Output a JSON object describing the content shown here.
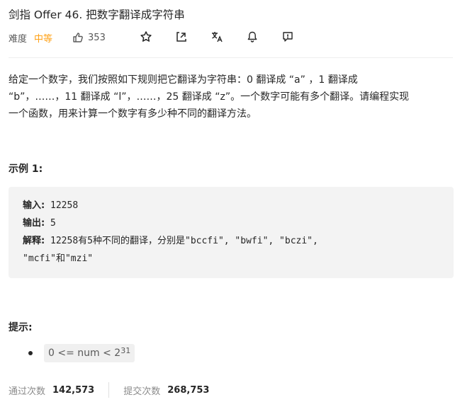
{
  "problem": {
    "title": "剑指 Offer 46. 把数字翻译成字符串",
    "difficulty_label": "难度",
    "difficulty_value": "中等",
    "likes": "353",
    "difficulty_color": "#ffa116"
  },
  "icons": {
    "like": "thumbs-up-icon",
    "star": "star-icon",
    "share": "share-icon",
    "translate": "translate-icon",
    "bell": "bell-icon",
    "feedback": "feedback-icon"
  },
  "description": {
    "line1": "给定一个数字，我们按照如下规则把它翻译为字符串：0 翻译成 “a” ，1 翻译成",
    "line2": "“b”，……，11 翻译成 “l”，……，25 翻译成 “z”。一个数字可能有多个翻译。请编程实现",
    "line3": "一个函数，用来计算一个数字有多少种不同的翻译方法。"
  },
  "example": {
    "heading": "示例 1:",
    "input_label": "输入:",
    "input_value": "12258",
    "output_label": "输出:",
    "output_value": "5",
    "explain_label": "解释:",
    "explain_line1": "12258有5种不同的翻译，分别是\"bccfi\", \"bwfi\", \"bczi\",",
    "explain_line2": "\"mcfi\"和\"mzi\""
  },
  "hint": {
    "heading": "提示:",
    "constraint": "0 <= num < 2",
    "exponent": "31"
  },
  "stats": {
    "accepted_label": "通过次数",
    "accepted_value": "142,573",
    "submitted_label": "提交次数",
    "submitted_value": "268,753"
  }
}
